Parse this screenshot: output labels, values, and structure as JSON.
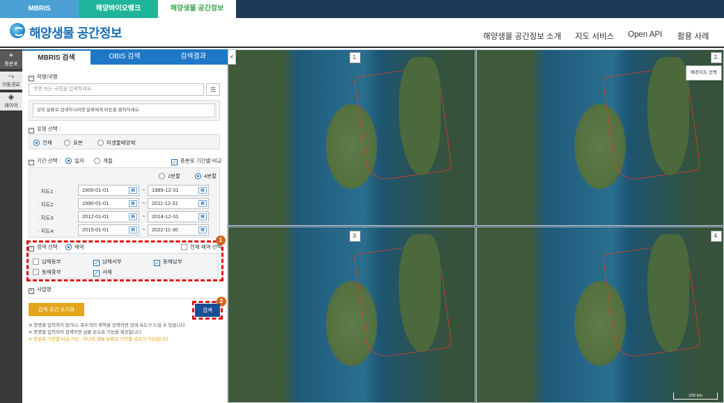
{
  "top_tabs": [
    "MBRIS",
    "해양바이오뱅크",
    "해양생물 공간정보"
  ],
  "header": {
    "brand": "해양생물 공간정보",
    "nav": [
      "해양생물 공간정보 소개",
      "지도 서비스",
      "Open API",
      "활용 사례"
    ]
  },
  "rail": [
    {
      "label": "종분포",
      "icon": "map-pin-icon"
    },
    {
      "label": "이동경로",
      "icon": "route-icon"
    },
    {
      "label": "레이어",
      "icon": "layers-icon"
    }
  ],
  "panel_tabs": [
    "MBRIS 검색",
    "OBIS 검색",
    "검색결과"
  ],
  "collapse_icon": "<",
  "search": {
    "scientific_title": "학명/국명",
    "scientific_placeholder": "학명 또는 국명을 입력하세요.",
    "hint": "상위 분류로 검색하시려면 분류체계 버튼을 클릭하세요.",
    "type_title": "유형 선택 :",
    "type_options": [
      "전체",
      "표본",
      "미생물배양체"
    ],
    "type_selected": "전체",
    "period_title": "기간 선택 :",
    "period_options": [
      "일자",
      "계절"
    ],
    "period_selected": "일자",
    "compare_label": "종분포 기간별 비교",
    "split_options": [
      "2분할",
      "4분할"
    ],
    "split_selected": "4분할",
    "maps": [
      {
        "label": "· 지도1",
        "from": "1900-01-01",
        "to": "1989-12-31"
      },
      {
        "label": "· 지도2",
        "from": "1990-01-01",
        "to": "2011-12-31"
      },
      {
        "label": "· 지도3",
        "from": "2012-01-01",
        "to": "2014-12-31"
      },
      {
        "label": "· 지도4",
        "from": "2015-01-01",
        "to": "2022-11-30"
      }
    ],
    "tilde": "~",
    "area_title": "영역 선택 :",
    "area_option": "해역",
    "area_all_label": "전체 해역 선택",
    "sea_areas": [
      {
        "label": "남해동부",
        "checked": false
      },
      {
        "label": "남해서부",
        "checked": true
      },
      {
        "label": "동해남부",
        "checked": true
      },
      {
        "label": "동해중부",
        "checked": false
      },
      {
        "label": "서해",
        "checked": true
      }
    ],
    "business_title": "사업명",
    "reset_button": "검색 조건 초기화",
    "search_button": "검색",
    "notes": [
      "※ 종명을 입력하지 않거나, 복수개의 해역을 선택하면 검색 속도가 느릴 수 있습니다.",
      "※ 종명을 입력하여 검색하면 심볼 온오프 기능을 제공합니다.",
      "※ 종분포 기간별 비교 기능 : 하나의 생물 분류로 기간별 비교가 가능합니다."
    ]
  },
  "annotations": [
    "1",
    "2"
  ],
  "map_panes": [
    "1.",
    "2.",
    "3.",
    "4."
  ],
  "basemap_button": "배경지도 선택",
  "scale_label": "100 km",
  "colors": {
    "accent": "#1b6db4",
    "reset": "#e4a51c",
    "search": "#1b4f93",
    "annotation": "#d11",
    "badge": "#d4661c"
  }
}
